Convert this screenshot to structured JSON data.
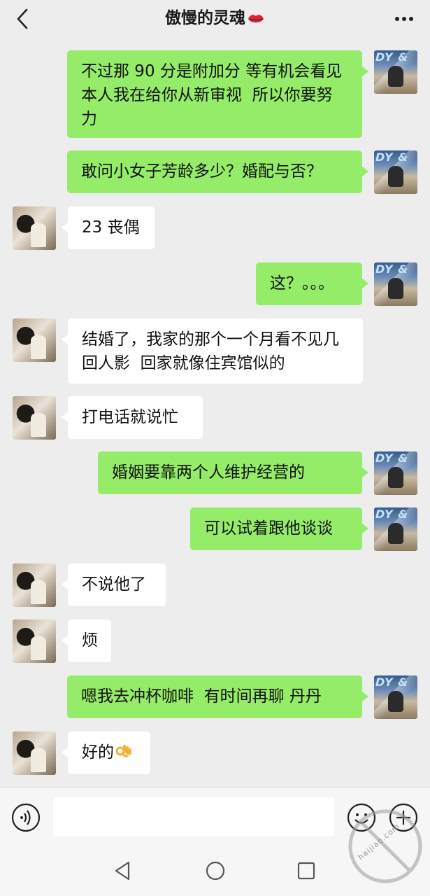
{
  "header": {
    "title": "傲慢的灵魂",
    "title_emoji": "kiss-lips-icon",
    "back_icon": "chevron-left-icon",
    "more_icon": "more-dots-icon"
  },
  "messages": [
    {
      "sender": "me",
      "text": "不过那 90 分是附加分 等有机会看见本人我在给你从新审视  所以你要努力"
    },
    {
      "sender": "me",
      "text": "敢问小女子芳龄多少？婚配与否？"
    },
    {
      "sender": "her",
      "text": "23 丧偶"
    },
    {
      "sender": "me",
      "text": "这？。。。"
    },
    {
      "sender": "her",
      "text": "结婚了，我家的那个一个月看不见几回人影  回家就像住宾馆似的"
    },
    {
      "sender": "her",
      "text": "打电话就说忙"
    },
    {
      "sender": "me",
      "text": "婚姻要靠两个人维护经营的"
    },
    {
      "sender": "me",
      "text": "可以试着跟他谈谈"
    },
    {
      "sender": "her",
      "text": "不说他了"
    },
    {
      "sender": "her",
      "text": "烦"
    },
    {
      "sender": "me",
      "text": "嗯我去冲杯咖啡  有时间再聊 丹丹"
    },
    {
      "sender": "her",
      "text": "好的",
      "emoji": "ok-hand-icon"
    }
  ],
  "input_bar": {
    "voice_icon": "voice-icon",
    "input_value": "",
    "emoji_icon": "emoji-icon",
    "plus_icon": "plus-icon"
  },
  "nav_bar": {
    "back_icon": "nav-back-icon",
    "home_icon": "nav-home-icon",
    "recent_icon": "nav-recent-icon"
  },
  "watermark": {
    "text": "haijiao.com"
  },
  "colors": {
    "background": "#ededed",
    "my_bubble": "#95ec69",
    "her_bubble": "#ffffff"
  }
}
